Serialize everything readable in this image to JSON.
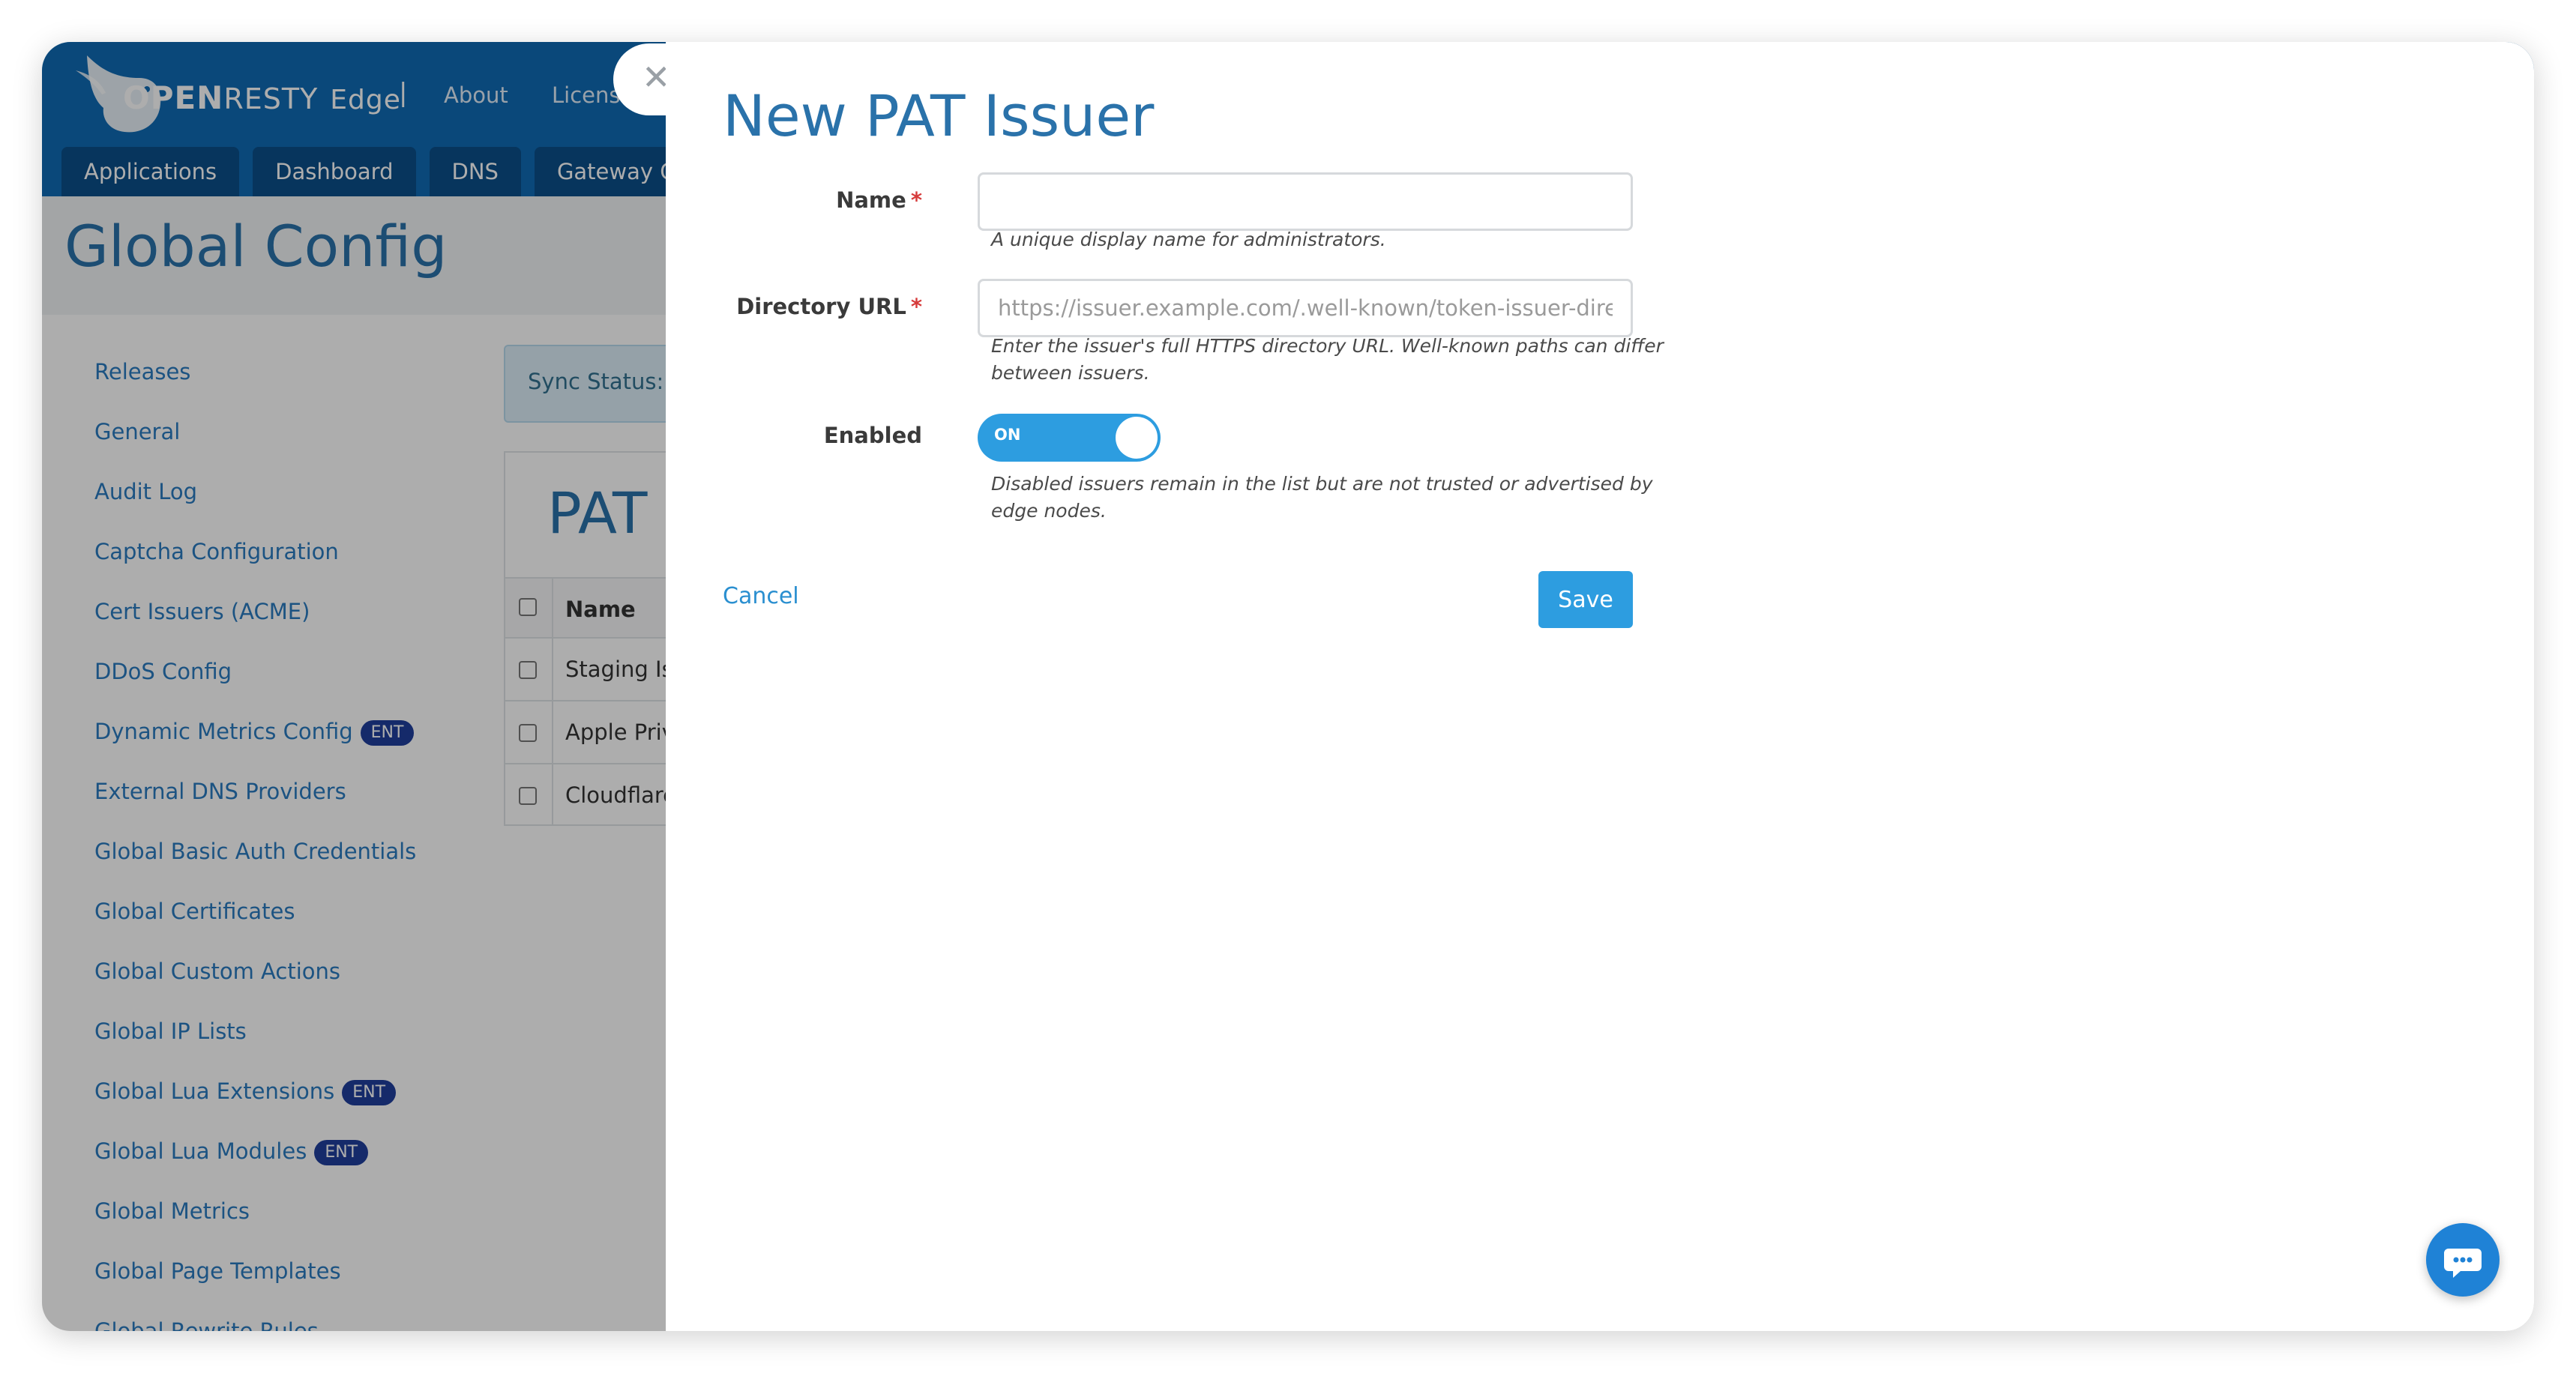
{
  "brand": {
    "open": "OPEN",
    "resty": "RESTY",
    "product": "Edge",
    "separator": "|"
  },
  "top_nav": {
    "about": "About",
    "license": "Licens"
  },
  "tabs": [
    "Applications",
    "Dashboard",
    "DNS",
    "Gateway Cl"
  ],
  "page_title": "Global Config",
  "sidebar": {
    "items": [
      {
        "label": "Releases",
        "badge": ""
      },
      {
        "label": "General",
        "badge": ""
      },
      {
        "label": "Audit Log",
        "badge": ""
      },
      {
        "label": "Captcha Configuration",
        "badge": ""
      },
      {
        "label": "Cert Issuers (ACME)",
        "badge": ""
      },
      {
        "label": "DDoS Config",
        "badge": ""
      },
      {
        "label": "Dynamic Metrics Config",
        "badge": "ENT"
      },
      {
        "label": "External DNS Providers",
        "badge": ""
      },
      {
        "label": "Global Basic Auth Credentials",
        "badge": ""
      },
      {
        "label": "Global Certificates",
        "badge": ""
      },
      {
        "label": "Global Custom Actions",
        "badge": ""
      },
      {
        "label": "Global IP Lists",
        "badge": ""
      },
      {
        "label": "Global Lua Extensions",
        "badge": "ENT"
      },
      {
        "label": "Global Lua Modules",
        "badge": "ENT"
      },
      {
        "label": "Global Metrics",
        "badge": ""
      },
      {
        "label": "Global Page Templates",
        "badge": ""
      },
      {
        "label": "Global Rewrite Rules",
        "badge": ""
      }
    ]
  },
  "sync_status": "Sync Status:",
  "panel": {
    "title": "PAT C",
    "column_name": "Name",
    "rows": [
      "Staging Is",
      "Apple Priv",
      "Cloudflare"
    ]
  },
  "drawer": {
    "title": "New PAT Issuer",
    "close_symbol": "✕",
    "required_marker": "*",
    "name": {
      "label": "Name",
      "value": "",
      "placeholder": "",
      "hint": "A unique display name for administrators."
    },
    "directory_url": {
      "label": "Directory URL",
      "value": "",
      "placeholder": "https://issuer.example.com/.well-known/token-issuer-directory",
      "hint": "Enter the issuer's full HTTPS directory URL. Well-known paths can differ between issuers."
    },
    "enabled": {
      "label": "Enabled",
      "state_text": "ON",
      "hint": "Disabled issuers remain in the list but are not trusted or advertised by edge nodes."
    },
    "cancel": "Cancel",
    "save": "Save"
  },
  "colors": {
    "brand_blue": "#0f6ab4",
    "accent": "#2d9de0",
    "title_blue": "#2a72aa",
    "required_red": "#d63b3b",
    "badge": "#1f3f9c"
  },
  "icons": {
    "close": "close-icon",
    "chat": "chat-bubble-icon",
    "logo": "openresty-bird-logo"
  }
}
